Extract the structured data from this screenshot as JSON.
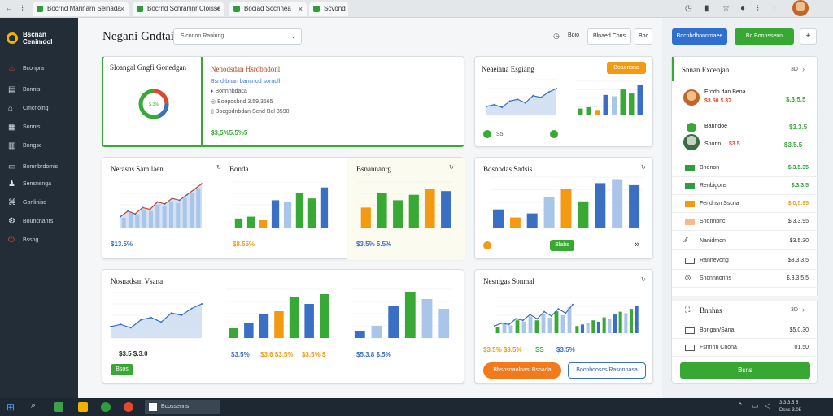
{
  "browser": {
    "tabs": [
      {
        "label": "Bocrnd Marinarn Seinada"
      },
      {
        "label": "Bocrnd Scnraninr Cloisse"
      },
      {
        "label": "Bociad Sccnnea"
      },
      {
        "label": "Scvond"
      }
    ],
    "toolbar_icons": [
      "clock-icon",
      "star-icon",
      "menu-icon"
    ]
  },
  "sidebar": {
    "logo_text": "Bscnan Cenimdol",
    "items": [
      {
        "label": "Bconpra",
        "icon": "flame-icon"
      },
      {
        "label": "Bonnis",
        "icon": "grid-icon"
      },
      {
        "label": "Cmcnolng",
        "icon": "home-icon"
      },
      {
        "label": "Sonnis",
        "icon": "chart-icon"
      },
      {
        "label": "Bongsc",
        "icon": "book-icon"
      },
      {
        "label": "Bomnbrdomis",
        "icon": "folder-icon"
      },
      {
        "label": "Sensnsnga",
        "icon": "users-icon"
      },
      {
        "label": "Gonlinisd",
        "icon": "network-icon"
      },
      {
        "label": "Bouncnanrs",
        "icon": "settings-icon"
      },
      {
        "label": "Bssng",
        "icon": "power-icon"
      }
    ]
  },
  "header": {
    "title": "Negani Gndtai",
    "search_value": "Sicnnon Raninng",
    "buttons": [
      "Boio",
      "Blnaed Cons",
      "Bbc"
    ],
    "primary_buttons": [
      "Bocnbdbonnmaee",
      "Bc Bonnssenn"
    ]
  },
  "cards": {
    "overview": {
      "title": "Sloangal Gngfi Gonedgan",
      "sub_title": "Nenodsdan Hsrdbndonl",
      "link": "Bsnd-bnan bancnod sornoll",
      "lines": [
        "Bonnnbdaca",
        "Boeposbnd 3.59,3565",
        "Bocgodnbdan Scnd Bol 3590"
      ],
      "value": "$3,5%5.5%5",
      "donut_label": "S.3%"
    },
    "nearest": {
      "title": "Neaeiana Esgiang",
      "badge": "Boaonsno",
      "foot": "S5"
    },
    "revenue": {
      "title": "Nerasns Samilaen",
      "value": "$13.5%"
    },
    "sources": {
      "title": "Bonda",
      "value": "$8.55%"
    },
    "recovery": {
      "title": "Bsnannanrg",
      "value": "$3.5% 5.5%"
    },
    "promote": {
      "title": "Bosnodas Sadsis",
      "badge": "Blabs"
    },
    "network": {
      "title": "Nosnadsan Vsana",
      "value": "$3.5 $.3.0",
      "badge": "Bsos",
      "mid_values": [
        "$3.5%",
        "$3.6 $3.5%",
        "$3.5% $"
      ],
      "bottom_value": "$5.3.8 $.5%"
    },
    "segment": {
      "title": "Nesnigas Sonmal",
      "values": [
        "$3.5% $3.5%",
        "SS",
        "$3.5%"
      ],
      "btn_primary": "Bbsosnaolnasi Bsnada",
      "btn_secondary": "Bocnbdoscs/Rasonnasa"
    }
  },
  "right_panel": {
    "title": "Snnan Excenjan",
    "header_link": "3D",
    "people": [
      {
        "name": "Erodo dan Bena",
        "sub": "$3.50 $.37",
        "value": "$.3.5.5"
      },
      {
        "name": "Banndoe",
        "sub": "",
        "value": "$3.3.5"
      },
      {
        "name": "Snonn",
        "sub": "$3.5",
        "value": "$3.5.5"
      }
    ],
    "rows": [
      {
        "label": "Bnonon",
        "value": "$.3.5.35",
        "color": "#2e9e3c"
      },
      {
        "label": "Renbigons",
        "value": "$.3.3.5",
        "color": "#2e9e3c"
      },
      {
        "label": "Fendnsn Sscna",
        "value": "$.0,5.95",
        "color": "#f39a12"
      },
      {
        "label": "Snonnbnc",
        "value": "$.3,3.95",
        "color": "#f39a12"
      },
      {
        "label": "Nanidmon",
        "value": "$3.5.30",
        "color": "#333333"
      },
      {
        "label": "Ranneyong",
        "value": "$3.3.3.5",
        "color": "#333333"
      },
      {
        "label": "Sncnnnonns",
        "value": "$.3.3.5.5",
        "color": "#333333"
      }
    ],
    "section2_title": "Bnnhns",
    "section2_link": "3D",
    "rows2": [
      {
        "label": "Bongan/Sana",
        "value": "$5.0.30"
      },
      {
        "label": "Fsnnnn Cnona",
        "value": "01.50"
      }
    ],
    "cta": "Bsns"
  },
  "taskbar": {
    "app_label": "Bcossenns",
    "clock": "3.3:3.5 5",
    "date": "Dsns 3.05"
  },
  "colors": {
    "blue": "#3a6fc4",
    "green": "#39a935",
    "orange": "#f39a12",
    "light_blue": "#a9c6ea"
  },
  "chart_data": [
    {
      "type": "area",
      "x": [
        1,
        2,
        3,
        4,
        5,
        6,
        7,
        8,
        9,
        10,
        11,
        12
      ],
      "values": [
        12,
        18,
        15,
        22,
        20,
        28,
        26,
        32,
        30,
        36,
        42,
        48
      ],
      "ylim": [
        0,
        50
      ]
    },
    {
      "type": "bar",
      "categories": [
        "a",
        "b",
        "c",
        "d",
        "e",
        "f",
        "g",
        "h"
      ],
      "series": [
        {
          "values": [
            10,
            12,
            8,
            30,
            28,
            38,
            32,
            44
          ]
        }
      ],
      "ylim": [
        0,
        50
      ]
    },
    {
      "type": "bar",
      "categories": [
        "a",
        "b",
        "c",
        "d",
        "e",
        "f"
      ],
      "series": [
        {
          "values": [
            22,
            38,
            30,
            36,
            42,
            40
          ]
        }
      ],
      "ylim": [
        0,
        50
      ]
    },
    {
      "type": "bar",
      "categories": [
        "a",
        "b",
        "c",
        "d",
        "e",
        "f",
        "g",
        "h",
        "i"
      ],
      "series": [
        {
          "values": [
            18,
            10,
            14,
            30,
            38,
            26,
            44,
            48,
            42
          ]
        }
      ],
      "ylim": [
        0,
        50
      ]
    },
    {
      "type": "area",
      "x": [
        1,
        2,
        3,
        4,
        5,
        6,
        7,
        8,
        9,
        10
      ],
      "values": [
        10,
        12,
        9,
        16,
        18,
        14,
        22,
        20,
        26,
        30
      ],
      "ylim": [
        0,
        40
      ]
    },
    {
      "type": "bar",
      "categories": [
        "a",
        "b",
        "c",
        "d",
        "e",
        "f",
        "g"
      ],
      "series": [
        {
          "values": [
            8,
            12,
            20,
            22,
            34,
            28,
            36
          ]
        }
      ],
      "ylim": [
        0,
        40
      ]
    },
    {
      "type": "bar",
      "categories": [
        "a",
        "b",
        "c",
        "d",
        "e",
        "f"
      ],
      "series": [
        {
          "values": [
            6,
            10,
            26,
            38,
            32,
            24
          ]
        }
      ],
      "ylim": [
        0,
        40
      ]
    },
    {
      "type": "line",
      "x": [
        1,
        2,
        3,
        4,
        5,
        6,
        7,
        8,
        9,
        10,
        11,
        12
      ],
      "values": [
        10,
        14,
        12,
        20,
        18,
        26,
        20,
        30,
        24,
        34,
        28,
        40
      ],
      "ylim": [
        0,
        50
      ]
    },
    {
      "type": "bar",
      "categories": [
        "a",
        "b",
        "c",
        "d",
        "e",
        "f",
        "g",
        "h",
        "i",
        "j",
        "k",
        "l"
      ],
      "series": [
        {
          "values": [
            10,
            12,
            14,
            18,
            16,
            22,
            20,
            26,
            30,
            28,
            34,
            38
          ]
        }
      ],
      "ylim": [
        0,
        50
      ]
    },
    {
      "type": "line",
      "x": [
        1,
        2,
        3,
        4,
        5,
        6,
        7,
        8,
        9
      ],
      "values": [
        12,
        18,
        14,
        26,
        20,
        30,
        24,
        32,
        36
      ],
      "ylim": [
        0,
        40
      ]
    }
  ]
}
